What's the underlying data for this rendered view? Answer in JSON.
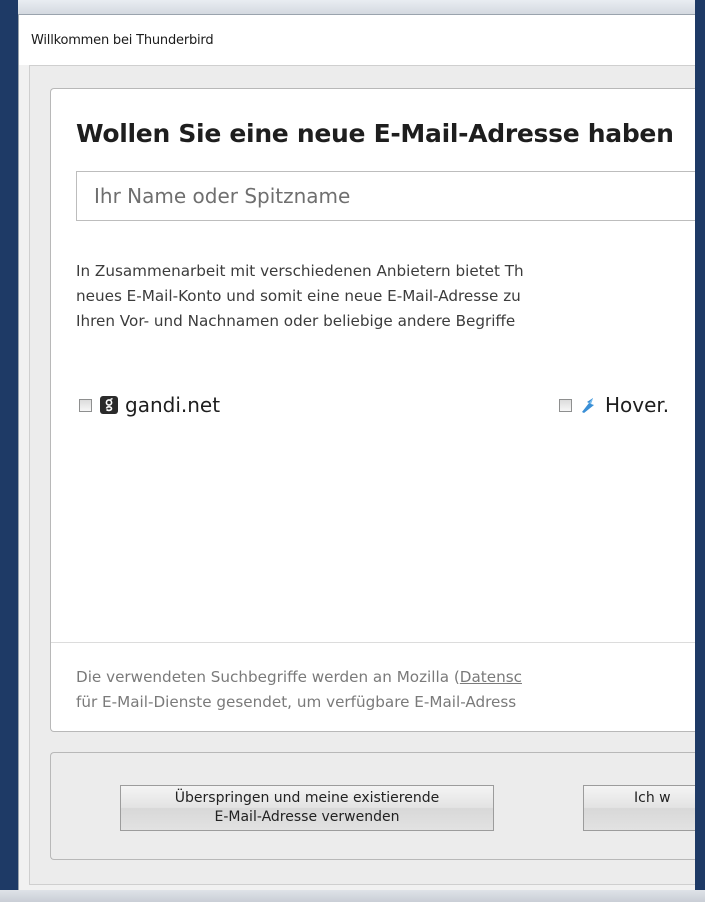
{
  "window": {
    "title": "Willkommen bei Thunderbird"
  },
  "main": {
    "heading": "Wollen Sie eine neue E-Mail-Adresse haben",
    "name_input": {
      "placeholder": "Ihr Name oder Spitzname",
      "value": ""
    },
    "description_lines": [
      "In Zusammenarbeit mit verschiedenen Anbietern bietet Th",
      "neues E-Mail-Konto und somit eine neue E-Mail-Adresse zu",
      "Ihren Vor- und Nachnamen oder beliebige andere Begriffe"
    ],
    "providers": [
      {
        "label": "gandi.net",
        "icon": "gandi-logo-icon",
        "checked": false
      },
      {
        "label": "Hover.",
        "icon": "hover-logo-icon",
        "checked": false
      }
    ],
    "footnote": {
      "line1_prefix": "Die verwendeten Suchbegriffe werden an Mozilla (",
      "line1_link": "Datensc",
      "line2": "für E-Mail-Dienste gesendet, um verfügbare E-Mail-Adress"
    }
  },
  "buttons": {
    "skip_line1": "Überspringen und meine existierende",
    "skip_line2": "E-Mail-Adresse verwenden",
    "want_label": "Ich w"
  },
  "colors": {
    "window_frame": "#1e3a66",
    "card_background": "#ffffff",
    "panel_background": "#ececec"
  }
}
